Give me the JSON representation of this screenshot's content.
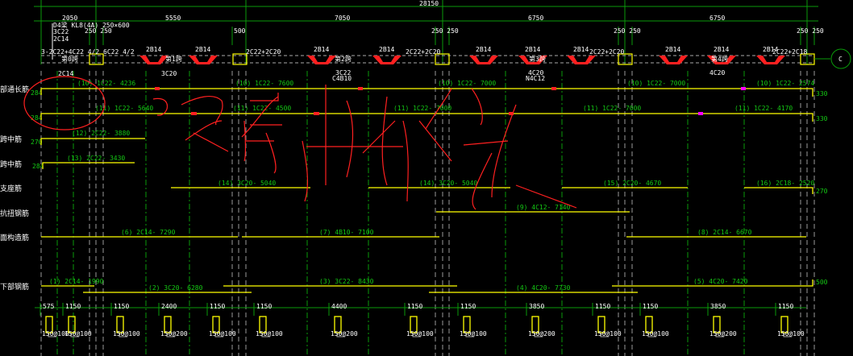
{
  "top_dims": {
    "total": "28150",
    "spans": [
      "2050",
      "5550",
      "7050",
      "6750",
      "6750"
    ],
    "col_widths": [
      "250 250",
      "500",
      "250 250",
      "250 250",
      "250 250"
    ]
  },
  "beam": {
    "title": "D4梁 KL8(4A) 250×600",
    "line2": "3C22",
    "line3": "2C14"
  },
  "support_rebar": [
    "3-2C22+4C22 4/2",
    "6C22 4/2",
    "2C22+2C20",
    "2C22+2C20",
    "2C22+2C20",
    "2C22+2C18"
  ],
  "waist_labels": [
    "2B14",
    "2B14",
    "2B14",
    "2B14",
    "2B14",
    "2B14",
    "2B14",
    "2B14",
    "2B14",
    "2B14"
  ],
  "spans": [
    "第0跨",
    "第1跨",
    "第2跨",
    "第3跨",
    "第4跨"
  ],
  "span_bottom": [
    "2C14",
    "3C20",
    "3C22",
    "C4B10",
    "4C20",
    "N4C12",
    "4C20"
  ],
  "axis_label": "C",
  "row_labels": [
    "部通长筋",
    "跨中筋",
    "跨中筋",
    "支座筋",
    "抗扭钢筋",
    "面构造筋",
    "下部钢筋"
  ],
  "anchor_left": [
    "284",
    "284",
    "270",
    "284"
  ],
  "anchor_right": [
    "330",
    "330",
    "270",
    "500"
  ],
  "bars": {
    "r1": [
      "(10) 1C22- 4236",
      "(10) 1C22- 7600",
      "(10) 1C22- 7000",
      "(10) 1C22- 7000",
      "(10) 1C22- 2574"
    ],
    "r2": [
      "(11) 1C22- 5640",
      "(11) 1C22- 4500",
      "(11) 1C22- 7000",
      "(11) 1C22- 7000",
      "(11) 1C22- 4170"
    ],
    "r3": [
      "(12) 2C22- 3880"
    ],
    "r4": [
      "(13) 2C22- 3430"
    ],
    "r5": [
      "(14) 3C20- 5040",
      "(14) 3C20- 5040",
      "(15) 2C20- 4670",
      "(16) 2C18- 2520"
    ],
    "r6": [
      "(9) 4C12- 7140"
    ],
    "r7": [
      "(6) 2C14- 7290",
      "(7) 4B10- 7100",
      "(8) 2C14- 6670"
    ],
    "r8": [
      "(1) 2C14- 1990",
      "(2) 3C20- 6280",
      "(3) 3C22- 8430",
      "(4) 4C20- 7730",
      "(5) 4C20- 7420"
    ]
  },
  "bottom_dims": [
    "575",
    "1150",
    "1150",
    "2400",
    "1150",
    "1150",
    "4400",
    "1150",
    "1150",
    "3850",
    "1150",
    "1150",
    "3850",
    "1150"
  ],
  "stirrups": [
    "150@100",
    "150@100",
    "150@100",
    "150@200",
    "150@100",
    "150@100",
    "150@200",
    "150@100",
    "150@100",
    "150@200",
    "150@100",
    "150@100",
    "150@200",
    "150@100"
  ],
  "colors": {
    "bar": "#ffff00",
    "grid": "#0a9a0a",
    "annotation": "#ff2020"
  }
}
